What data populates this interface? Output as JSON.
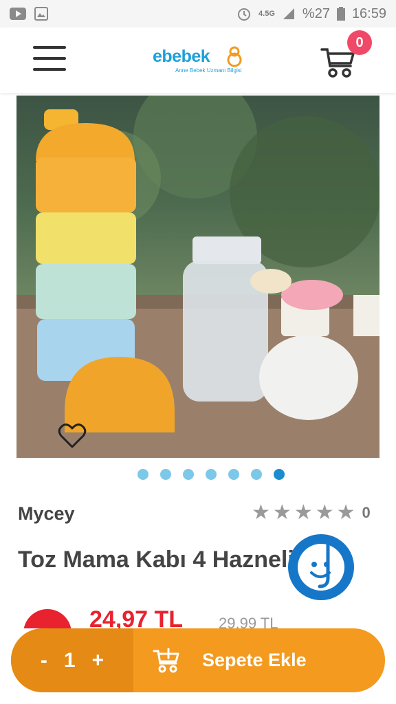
{
  "status_bar": {
    "network": "4.5G",
    "battery": "%27",
    "time": "16:59"
  },
  "header": {
    "logo_text": "ebebek",
    "logo_tagline": "Anne Bebek Uzmanı Bilgisi",
    "cart_count": "0"
  },
  "product": {
    "brand": "Mycey",
    "rating_count": "0",
    "stars_filled": 0,
    "title": "Toz Mama Kabı 4 Hazneli",
    "price": "24,97 TL",
    "old_price": "29,99 TL"
  },
  "gallery": {
    "total_images": 7,
    "active_index": 6
  },
  "bottom_bar": {
    "minus": "-",
    "quantity": "1",
    "plus": "+",
    "add_to_cart": "Sepete Ekle"
  },
  "colors": {
    "brand_blue": "#1ea0d8",
    "badge_pink": "#f04868",
    "cta_orange": "#f39a1f",
    "qty_orange": "#e58a14",
    "price_red": "#e8222e",
    "chat_blue": "#1677c9"
  },
  "icons": {
    "status_left": [
      "youtube-icon",
      "gallery-icon"
    ],
    "status_right": [
      "alarm-icon",
      "signal-icon",
      "battery-icon"
    ],
    "menu": "hamburger-icon",
    "cart": "cart-icon",
    "favorite": "heart-icon",
    "chat": "chat-smile-icon"
  }
}
